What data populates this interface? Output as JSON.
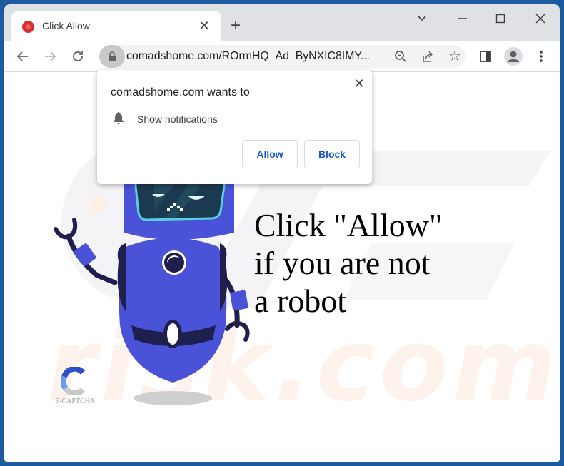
{
  "browser": {
    "tab": {
      "title": "Click Allow",
      "favicon": "red-circle-icon",
      "close_glyph": "✕"
    },
    "new_tab_glyph": "+",
    "window_controls": {
      "tab_search": "⌄",
      "minimize": "—",
      "maximize": "☐",
      "close": "✕"
    },
    "toolbar": {
      "back": "←",
      "forward": "→",
      "reload": "↻",
      "url": "comadshome.com/ROrmHQ_Ad_ByNXIC8IMY...",
      "zoom_icon": "zoom-out-icon",
      "share_icon": "share-icon",
      "bookmark_glyph": "☆",
      "menu_glyph": "⋮"
    }
  },
  "permission_popup": {
    "title": "comadshome.com wants to",
    "permission": "Show notifications",
    "close_glyph": "✕",
    "allow_label": "Allow",
    "block_label": "Block"
  },
  "page": {
    "headline_lines": [
      "Click \"Allow\"",
      "if you are not",
      "a robot"
    ],
    "captcha_label": "E-CAPTCHA",
    "watermark": "risk.com",
    "colors": {
      "robot_body": "#4a52d8",
      "robot_dark": "#1e1f4e",
      "visor": "#1b3a4f",
      "visor_rim": "#5ad0e0",
      "button_text": "#1a56c4"
    }
  }
}
